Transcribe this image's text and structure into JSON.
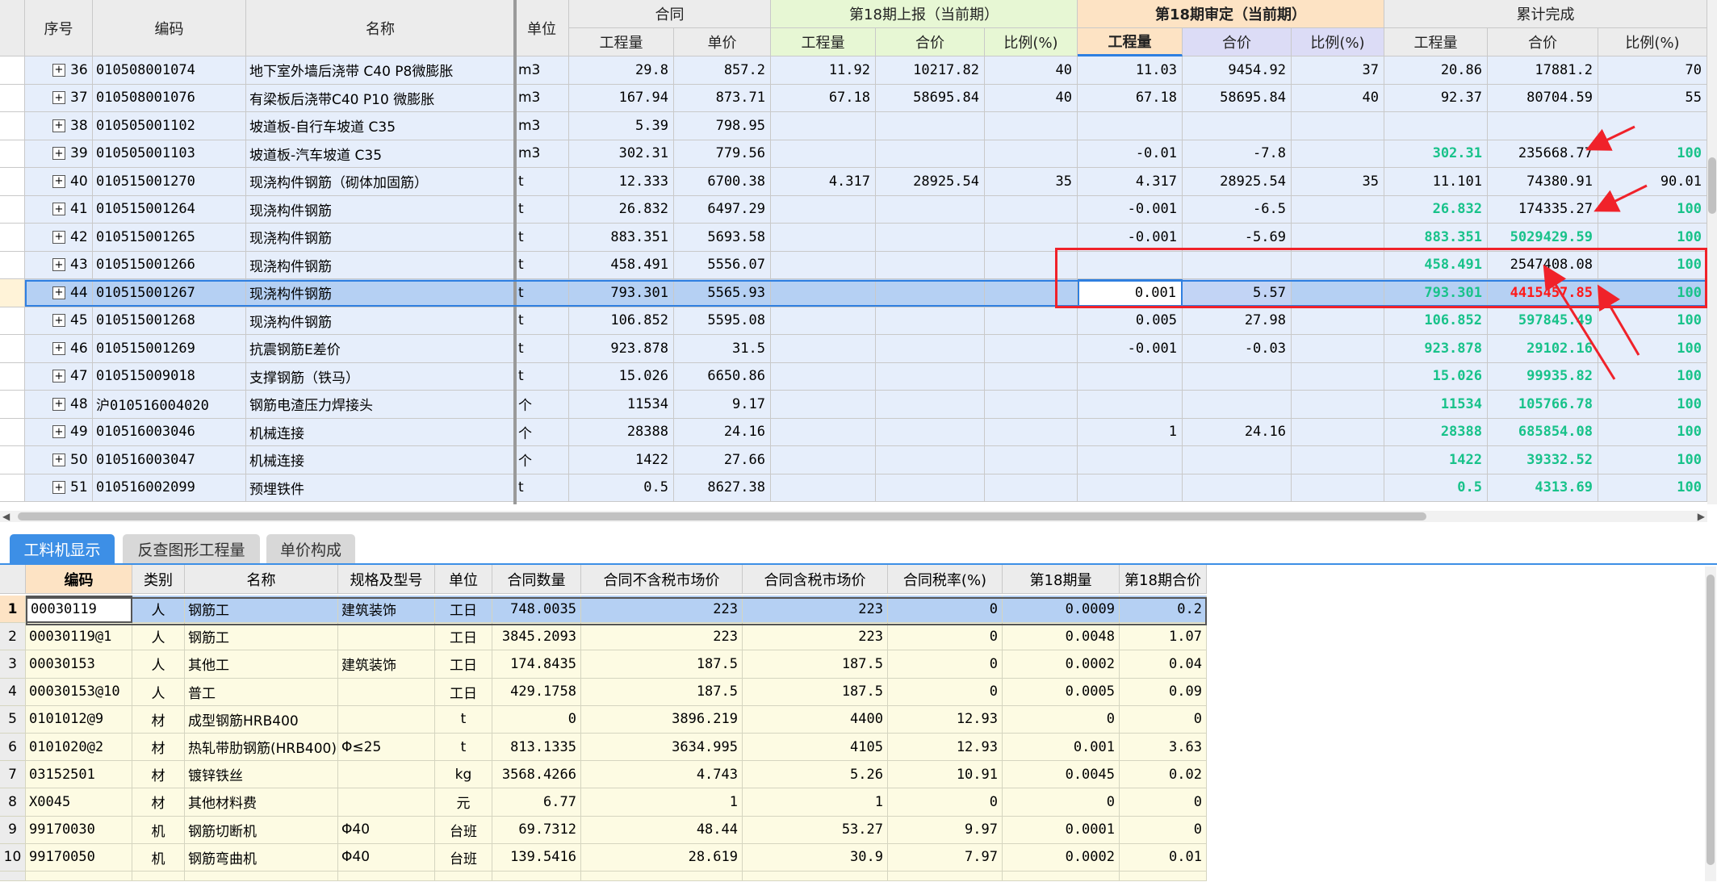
{
  "upper_headers": {
    "row1": {
      "seq": "序号",
      "code": "编码",
      "name": "名称",
      "unit": "单位",
      "contract": "合同",
      "reported": "第18期上报（当前期）",
      "approved": "第18期审定（当前期）",
      "cumulative": "累计完成"
    },
    "row2": [
      "工程量",
      "单价",
      "工程量",
      "合价",
      "比例(%)",
      "工程量",
      "合价",
      "比例(%)",
      "工程量",
      "合价",
      "比例(%)"
    ]
  },
  "upper_rows": [
    {
      "no": "36",
      "code": "010508001074",
      "name": "地下室外墙后浇带 C40 P8微膨胀",
      "unit": "m3",
      "qty": "29.8",
      "price": "857.2",
      "rq": "11.92",
      "rt": "10217.82",
      "rp": "40",
      "aq": "11.03",
      "at": "9454.92",
      "ap": "37",
      "cq": "20.86",
      "ct": "17881.2",
      "cp": "70",
      "green": false
    },
    {
      "no": "37",
      "code": "010508001076",
      "name": "有梁板后浇带C40 P10 微膨胀",
      "unit": "m3",
      "qty": "167.94",
      "price": "873.71",
      "rq": "67.18",
      "rt": "58695.84",
      "rp": "40",
      "aq": "67.18",
      "at": "58695.84",
      "ap": "40",
      "cq": "92.37",
      "ct": "80704.59",
      "cp": "55",
      "green": false
    },
    {
      "no": "38",
      "code": "010505001102",
      "name": "坡道板-自行车坡道 C35",
      "unit": "m3",
      "qty": "5.39",
      "price": "798.95",
      "rq": "",
      "rt": "",
      "rp": "",
      "aq": "",
      "at": "",
      "ap": "",
      "cq": "",
      "ct": "",
      "cp": "",
      "green": false
    },
    {
      "no": "39",
      "code": "010505001103",
      "name": "坡道板-汽车坡道 C35",
      "unit": "m3",
      "qty": "302.31",
      "price": "779.56",
      "rq": "",
      "rt": "",
      "rp": "",
      "aq": "-0.01",
      "at": "-7.8",
      "ap": "",
      "cq": "302.31",
      "ct": "235668.77",
      "cp": "100",
      "green": true,
      "ct_plain": true
    },
    {
      "no": "40",
      "code": "010515001270",
      "name": "现浇构件钢筋（砌体加固筋）",
      "unit": "t",
      "qty": "12.333",
      "price": "6700.38",
      "rq": "4.317",
      "rt": "28925.54",
      "rp": "35",
      "aq": "4.317",
      "at": "28925.54",
      "ap": "35",
      "cq": "11.101",
      "ct": "74380.91",
      "cp": "90.01",
      "green": false
    },
    {
      "no": "41",
      "code": "010515001264",
      "name": "现浇构件钢筋",
      "unit": "t",
      "qty": "26.832",
      "price": "6497.29",
      "rq": "",
      "rt": "",
      "rp": "",
      "aq": "-0.001",
      "at": "-6.5",
      "ap": "",
      "cq": "26.832",
      "ct": "174335.27",
      "cp": "100",
      "green": true,
      "ct_plain": true
    },
    {
      "no": "42",
      "code": "010515001265",
      "name": "现浇构件钢筋",
      "unit": "t",
      "qty": "883.351",
      "price": "5693.58",
      "rq": "",
      "rt": "",
      "rp": "",
      "aq": "-0.001",
      "at": "-5.69",
      "ap": "",
      "cq": "883.351",
      "ct": "5029429.59",
      "cp": "100",
      "green": true
    },
    {
      "no": "43",
      "code": "010515001266",
      "name": "现浇构件钢筋",
      "unit": "t",
      "qty": "458.491",
      "price": "5556.07",
      "rq": "",
      "rt": "",
      "rp": "",
      "aq": "",
      "at": "",
      "ap": "",
      "cq": "458.491",
      "ct": "2547408.08",
      "cp": "100",
      "green": true,
      "ct_plain": true
    },
    {
      "no": "44",
      "code": "010515001267",
      "name": "现浇构件钢筋",
      "unit": "t",
      "qty": "793.301",
      "price": "5565.93",
      "rq": "",
      "rt": "",
      "rp": "",
      "aq": "0.001",
      "at": "5.57",
      "ap": "",
      "cq": "793.301",
      "ct": "4415457.85",
      "cp": "100",
      "green": true,
      "ct_red": true,
      "selected": true
    },
    {
      "no": "45",
      "code": "010515001268",
      "name": "现浇构件钢筋",
      "unit": "t",
      "qty": "106.852",
      "price": "5595.08",
      "rq": "",
      "rt": "",
      "rp": "",
      "aq": "0.005",
      "at": "27.98",
      "ap": "",
      "cq": "106.852",
      "ct": "597845.49",
      "cp": "100",
      "green": true
    },
    {
      "no": "46",
      "code": "010515001269",
      "name": "抗震钢筋E差价",
      "unit": "t",
      "qty": "923.878",
      "price": "31.5",
      "rq": "",
      "rt": "",
      "rp": "",
      "aq": "-0.001",
      "at": "-0.03",
      "ap": "",
      "cq": "923.878",
      "ct": "29102.16",
      "cp": "100",
      "green": true
    },
    {
      "no": "47",
      "code": "010515009018",
      "name": "支撑钢筋（铁马）",
      "unit": "t",
      "qty": "15.026",
      "price": "6650.86",
      "rq": "",
      "rt": "",
      "rp": "",
      "aq": "",
      "at": "",
      "ap": "",
      "cq": "15.026",
      "ct": "99935.82",
      "cp": "100",
      "green": true
    },
    {
      "no": "48",
      "code": "沪010516004020",
      "name": "钢筋电渣压力焊接头",
      "unit": "个",
      "qty": "11534",
      "price": "9.17",
      "rq": "",
      "rt": "",
      "rp": "",
      "aq": "",
      "at": "",
      "ap": "",
      "cq": "11534",
      "ct": "105766.78",
      "cp": "100",
      "green": true
    },
    {
      "no": "49",
      "code": "010516003046",
      "name": "机械连接",
      "unit": "个",
      "qty": "28388",
      "price": "24.16",
      "rq": "",
      "rt": "",
      "rp": "",
      "aq": "1",
      "at": "24.16",
      "ap": "",
      "cq": "28388",
      "ct": "685854.08",
      "cp": "100",
      "green": true
    },
    {
      "no": "50",
      "code": "010516003047",
      "name": "机械连接",
      "unit": "个",
      "qty": "1422",
      "price": "27.66",
      "rq": "",
      "rt": "",
      "rp": "",
      "aq": "",
      "at": "",
      "ap": "",
      "cq": "1422",
      "ct": "39332.52",
      "cp": "100",
      "green": true
    },
    {
      "no": "51",
      "code": "010516002099",
      "name": "预埋铁件",
      "unit": "t",
      "qty": "0.5",
      "price": "8627.38",
      "rq": "",
      "rt": "",
      "rp": "",
      "aq": "",
      "at": "",
      "ap": "",
      "cq": "0.5",
      "ct": "4313.69",
      "cp": "100",
      "green": true
    }
  ],
  "tabs": [
    "工料机显示",
    "反查图形工程量",
    "单价构成"
  ],
  "lower_headers": [
    "编码",
    "类别",
    "名称",
    "规格及型号",
    "单位",
    "合同数量",
    "合同不含税市场价",
    "合同含税市场价",
    "合同税率(%)",
    "第18期量",
    "第18期合价"
  ],
  "lower_rows": [
    {
      "n": "1",
      "code": "00030119",
      "cat": "人",
      "name": "钢筋工",
      "spec": "建筑装饰",
      "unit": "工日",
      "cqty": "748.0035",
      "pex": "223",
      "pin": "223",
      "tax": "0",
      "q18": "0.0009",
      "t18": "0.2",
      "selected": true
    },
    {
      "n": "2",
      "code": "00030119@1",
      "cat": "人",
      "name": "钢筋工",
      "spec": "",
      "unit": "工日",
      "cqty": "3845.2093",
      "pex": "223",
      "pin": "223",
      "tax": "0",
      "q18": "0.0048",
      "t18": "1.07"
    },
    {
      "n": "3",
      "code": "00030153",
      "cat": "人",
      "name": "其他工",
      "spec": "建筑装饰",
      "unit": "工日",
      "cqty": "174.8435",
      "pex": "187.5",
      "pin": "187.5",
      "tax": "0",
      "q18": "0.0002",
      "t18": "0.04"
    },
    {
      "n": "4",
      "code": "00030153@10",
      "cat": "人",
      "name": "普工",
      "spec": "",
      "unit": "工日",
      "cqty": "429.1758",
      "pex": "187.5",
      "pin": "187.5",
      "tax": "0",
      "q18": "0.0005",
      "t18": "0.09"
    },
    {
      "n": "5",
      "code": "0101012@9",
      "cat": "材",
      "name": "成型钢筋HRB400",
      "spec": "",
      "unit": "t",
      "cqty": "0",
      "pex": "3896.219",
      "pin": "4400",
      "tax": "12.93",
      "q18": "0",
      "t18": "0"
    },
    {
      "n": "6",
      "code": "0101020@2",
      "cat": "材",
      "name": "热轧带肋钢筋(HRB400)",
      "spec": "Φ≤25",
      "unit": "t",
      "cqty": "813.1335",
      "pex": "3634.995",
      "pin": "4105",
      "tax": "12.93",
      "q18": "0.001",
      "t18": "3.63"
    },
    {
      "n": "7",
      "code": "03152501",
      "cat": "材",
      "name": "镀锌铁丝",
      "spec": "",
      "unit": "kg",
      "cqty": "3568.4266",
      "pex": "4.743",
      "pin": "5.26",
      "tax": "10.91",
      "q18": "0.0045",
      "t18": "0.02"
    },
    {
      "n": "8",
      "code": "X0045",
      "cat": "材",
      "name": "其他材料费",
      "spec": "",
      "unit": "元",
      "cqty": "6.77",
      "pex": "1",
      "pin": "1",
      "tax": "0",
      "q18": "0",
      "t18": "0"
    },
    {
      "n": "9",
      "code": "99170030",
      "cat": "机",
      "name": "钢筋切断机",
      "spec": "Φ40",
      "unit": "台班",
      "cqty": "69.7312",
      "pex": "48.44",
      "pin": "53.27",
      "tax": "9.97",
      "q18": "0.0001",
      "t18": "0"
    },
    {
      "n": "10",
      "code": "99170050",
      "cat": "机",
      "name": "钢筋弯曲机",
      "spec": "Φ40",
      "unit": "台班",
      "cqty": "139.5416",
      "pex": "28.619",
      "pin": "30.9",
      "tax": "7.97",
      "q18": "0.0002",
      "t18": "0.01"
    }
  ],
  "colors": {
    "green_text": "#18c28a",
    "red_text": "#ff1a1a",
    "highlight_box": "#f0222a",
    "tab_active": "#3d8fe6"
  }
}
